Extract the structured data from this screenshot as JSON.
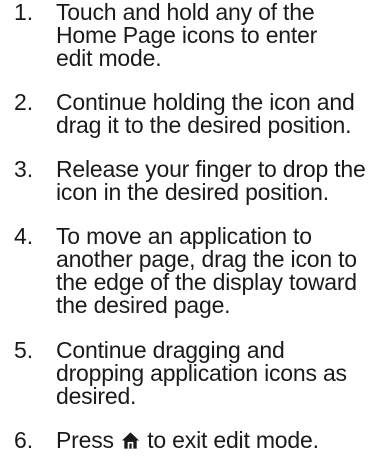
{
  "steps": [
    {
      "number": "1.",
      "text": "Touch and hold any of the\nHome Page icons to enter\nedit mode."
    },
    {
      "number": "2.",
      "text": "Continue holding the icon and\ndrag it to the desired position."
    },
    {
      "number": "3.",
      "text": "Release your finger to drop the\nicon in the desired position."
    },
    {
      "number": "4.",
      "text": "To move an application to\nanother page, drag the icon to\nthe edge of the display toward\nthe desired page."
    },
    {
      "number": "5.",
      "text": "Continue dragging and\ndropping application icons as\ndesired."
    },
    {
      "number": "6.",
      "text_before": "Press",
      "icon": "home-icon",
      "text_after": "to exit edit mode."
    }
  ]
}
